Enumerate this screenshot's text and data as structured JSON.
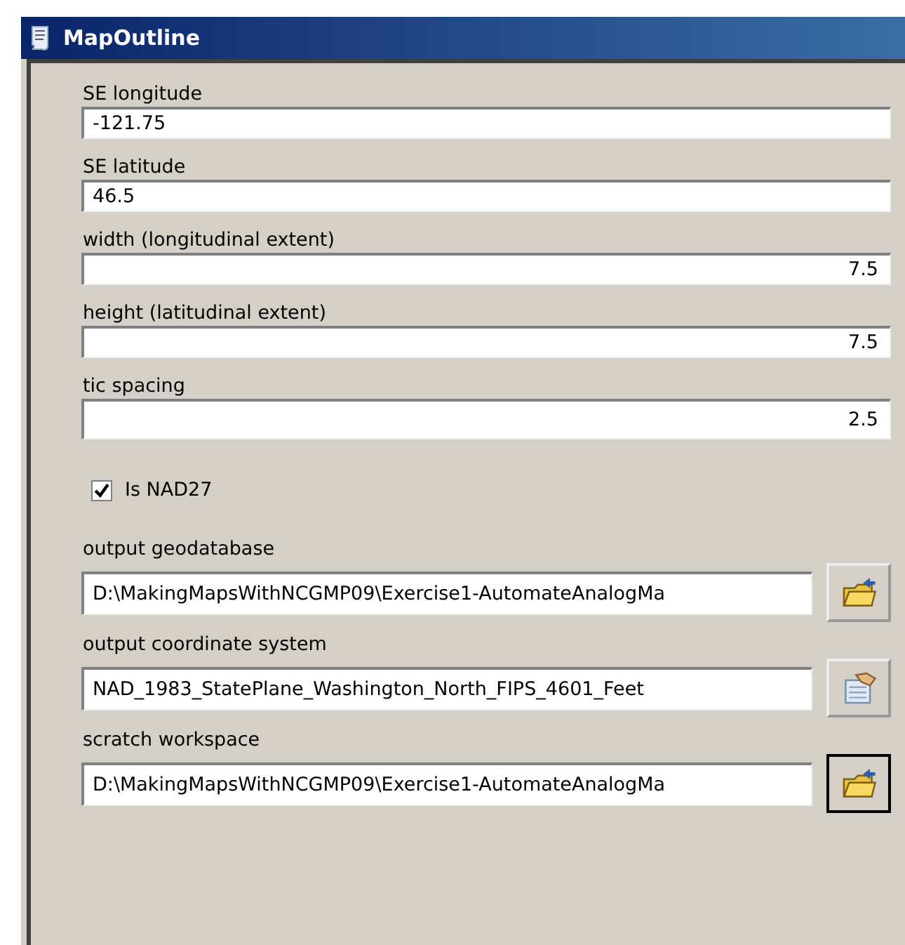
{
  "window": {
    "title": "MapOutline"
  },
  "fields": [
    {
      "kind": "text",
      "label": "SE longitude",
      "value": "-121.75"
    },
    {
      "kind": "text",
      "label": "SE latitude",
      "value": "46.5"
    },
    {
      "kind": "number",
      "label": "width (longitudinal extent)",
      "value": "7.5"
    },
    {
      "kind": "number",
      "label": "height (latitudinal extent)",
      "value": "7.5"
    },
    {
      "kind": "number",
      "label": "tic spacing",
      "value": "2.5"
    },
    {
      "kind": "checkbox",
      "label": "Is NAD27",
      "checked": true
    },
    {
      "kind": "folder",
      "label": "output geodatabase",
      "value": "D:\\MakingMapsWithNCGMP09\\Exercise1-AutomateAnalogMa",
      "focused": false
    },
    {
      "kind": "coordsys",
      "label": "output coordinate system",
      "value": "NAD_1983_StatePlane_Washington_North_FIPS_4601_Feet",
      "focused": false
    },
    {
      "kind": "folder",
      "label": "scratch workspace",
      "value": "D:\\MakingMapsWithNCGMP09\\Exercise1-AutomateAnalogMa",
      "focused": true
    }
  ]
}
